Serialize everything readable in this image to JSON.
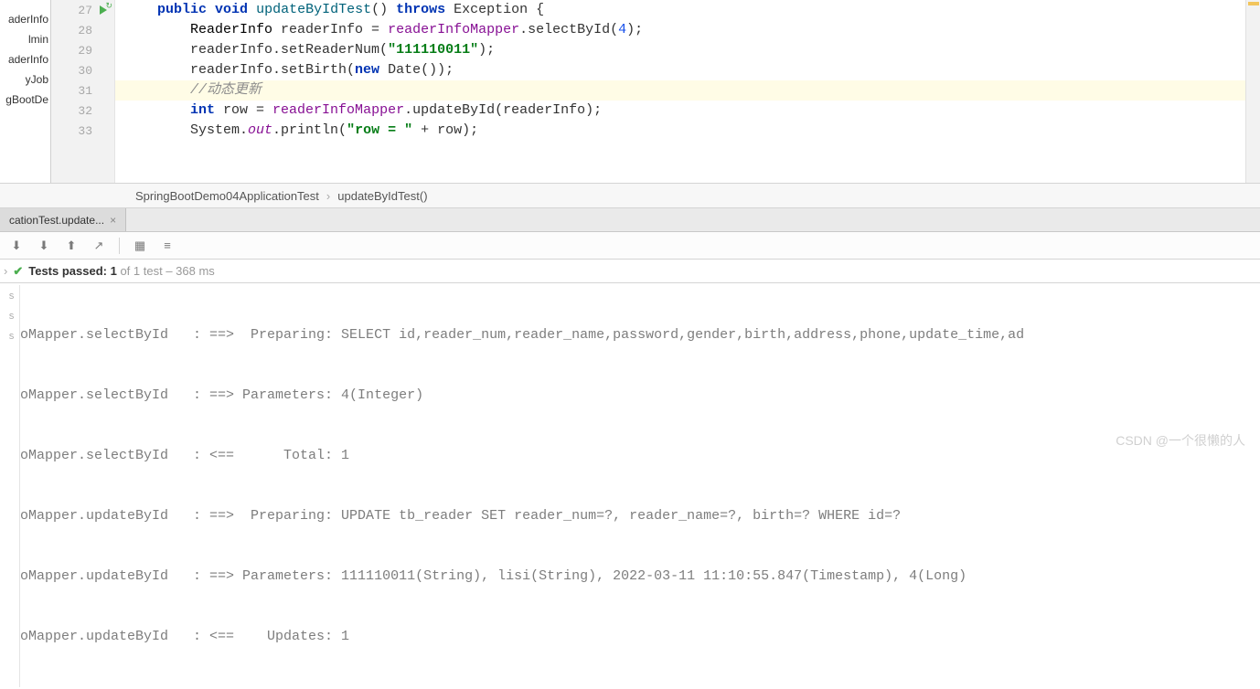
{
  "tree": {
    "items": [
      "aderInfo",
      "lmin",
      "aderInfo",
      "yJob",
      "gBootDe"
    ]
  },
  "gutter": {
    "lines": [
      "27",
      "28",
      "29",
      "30",
      "31",
      "32",
      "33"
    ]
  },
  "code": {
    "l27": {
      "indent": "    ",
      "kw1": "public",
      "kw2": "void",
      "method": "updateByIdTest",
      "p1": "() ",
      "kw3": "throws",
      "exc": " Exception {"
    },
    "l28": {
      "indent": "        ",
      "cls": "ReaderInfo",
      "var": " readerInfo = ",
      "fld": "readerInfoMapper",
      "call": ".selectById(",
      "num": "4",
      "end": ");"
    },
    "l29": {
      "indent": "        ",
      "obj": "readerInfo.setReaderNum(",
      "str": "\"111110011\"",
      "end": ");"
    },
    "l30": {
      "indent": "        ",
      "obj": "readerInfo.setBirth(",
      "kw": "new",
      "rest": " Date());"
    },
    "l31": {
      "indent": "        ",
      "cmt": "//动态更新"
    },
    "l32": {
      "indent": "        ",
      "kw": "int",
      "rest1": " row = ",
      "fld": "readerInfoMapper",
      "rest2": ".updateById(readerInfo);"
    },
    "l33": {
      "indent": "        ",
      "sys": "System.",
      "out": "out",
      "rest": ".println(",
      "str": "\"row = \"",
      "rest2": " + row);"
    }
  },
  "breadcrumb": {
    "item1": "SpringBootDemo04ApplicationTest",
    "item2": "updateByIdTest()"
  },
  "runTab": {
    "label": "cationTest.update..."
  },
  "testsStatus": {
    "text1": "Tests passed: 1",
    "text2": " of 1 test – 368 ms"
  },
  "console": {
    "lines": [
      "oMapper.selectById   : ==>  Preparing: SELECT id,reader_num,reader_name,password,gender,birth,address,phone,update_time,ad",
      "oMapper.selectById   : ==> Parameters: 4(Integer)",
      "oMapper.selectById   : <==      Total: 1",
      "oMapper.updateById   : ==>  Preparing: UPDATE tb_reader SET reader_num=?, reader_name=?, birth=? WHERE id=?",
      "oMapper.updateById   : ==> Parameters: 111110011(String), lisi(String), 2022-03-11 11:10:55.847(Timestamp), 4(Long)",
      "oMapper.updateById   : <==    Updates: 1"
    ],
    "sideLabels": [
      "s",
      "s",
      "",
      "",
      "",
      ""
    ]
  },
  "watermark": "CSDN @一个很懒的人"
}
